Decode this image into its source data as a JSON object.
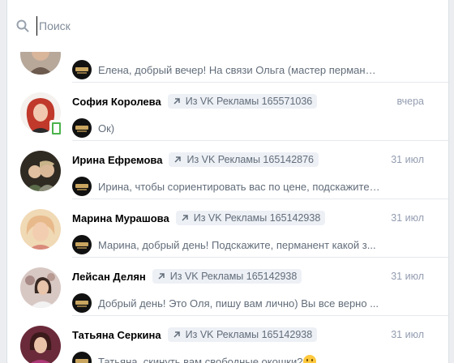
{
  "search": {
    "placeholder": "Поиск",
    "value": ""
  },
  "conversations": [
    {
      "name": "",
      "source": "",
      "date": "",
      "message": "Елена, добрый вечер! На связи Ольга (мастер перманент...",
      "avatar_color": "#8f7b6c",
      "mobile": false,
      "partial": true
    },
    {
      "name": "София Королева",
      "source": "Из VK Рекламы 165571036",
      "date": "вчера",
      "message": "Ок)",
      "avatar_color": "#c0392b",
      "mobile": true
    },
    {
      "name": "Ирина Ефремова",
      "source": "Из VK Рекламы 165142876",
      "date": "31 июл",
      "message": "Ирина, чтобы сориентировать вас по цене, подскажите,...",
      "avatar_color": "#3b3226",
      "mobile": false
    },
    {
      "name": "Марина Мурашова",
      "source": "Из VK Рекламы 165142938",
      "date": "31 июл",
      "message": "Марина, добрый день! Подскажите, перманент какой з...",
      "avatar_color": "#e8b98a",
      "mobile": false
    },
    {
      "name": "Лейсан Делян",
      "source": "Из VK Рекламы 165142938",
      "date": "31 июл",
      "message": "Добрый день! Это Оля, пишу вам лично) Вы все верно ...",
      "avatar_color": "#c9a9a6",
      "mobile": false
    },
    {
      "name": "Татьяна Серкина",
      "source": "Из VK Рекламы 165142938",
      "date": "31 июл",
      "message": "Татьяна, скинуть вам свободные окошки?",
      "avatar_color": "#a0306a",
      "mobile": false,
      "emoji": "slightly-smiling-face"
    }
  ]
}
